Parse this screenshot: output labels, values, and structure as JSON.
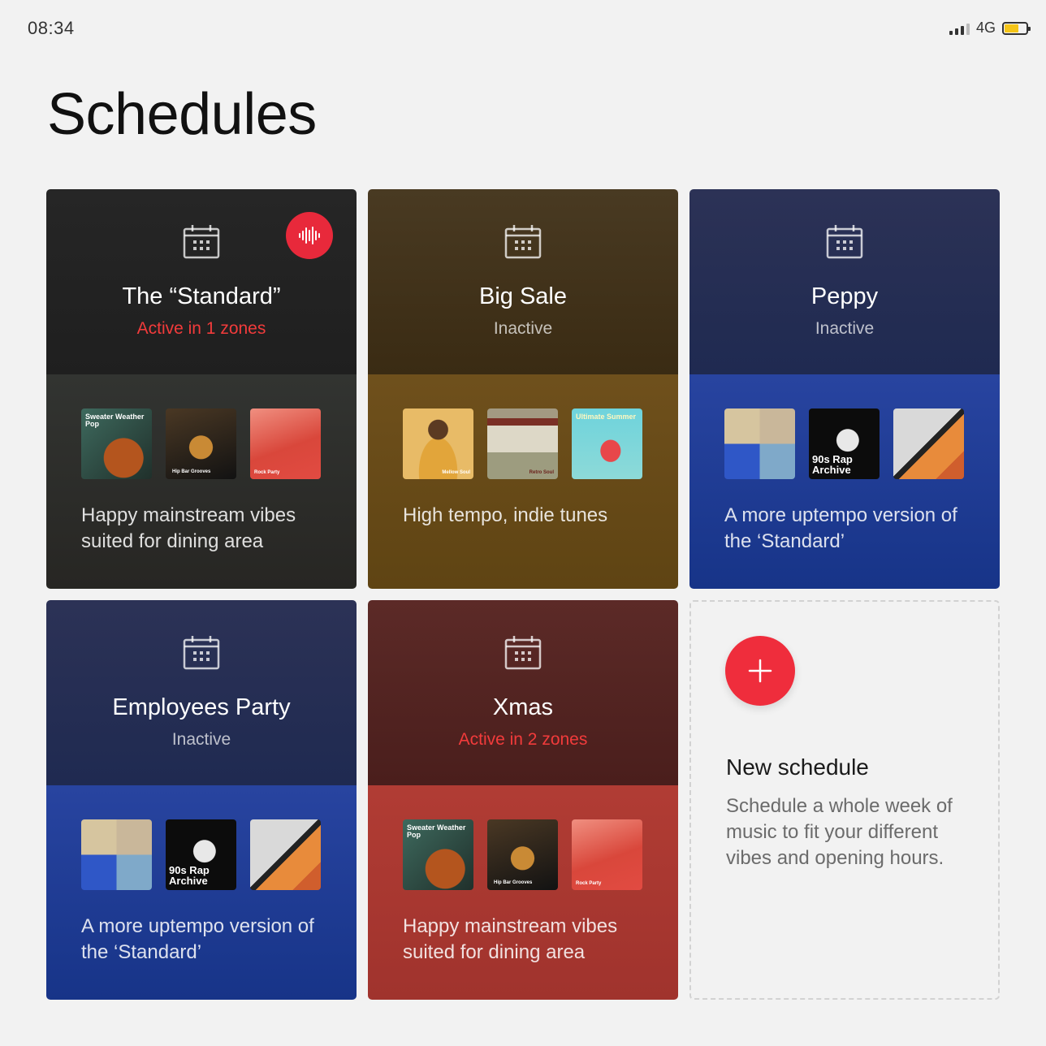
{
  "status_bar": {
    "time": "08:34",
    "network": "4G",
    "battery_level": 0.65,
    "battery_color": "#f5c518"
  },
  "page": {
    "title": "Schedules"
  },
  "accent_color": "#e8293b",
  "schedules": [
    {
      "title": "The “Standard”",
      "status": "Active in 1 zones",
      "active": true,
      "now_playing": true,
      "description": "Happy mainstream vibes suited for dining area",
      "playlists": [
        "Sweater Weather Pop",
        "Hip Bar Grooves",
        "Rock Party"
      ]
    },
    {
      "title": "Big Sale",
      "status": "Inactive",
      "active": false,
      "description": "High tempo, indie tunes",
      "playlists": [
        "Mellow Soul",
        "Retro Soul",
        "Ultimate Summer"
      ]
    },
    {
      "title": "Peppy",
      "status": "Inactive",
      "active": false,
      "description": "A more uptempo version of the ‘Standard’",
      "playlists": [
        "",
        "90s Rap Archive",
        ""
      ]
    },
    {
      "title": "Employees Party",
      "status": "Inactive",
      "active": false,
      "description": "A more uptempo version of the ‘Standard’",
      "playlists": [
        "",
        "90s Rap Archive",
        ""
      ]
    },
    {
      "title": "Xmas",
      "status": "Active in 2 zones",
      "active": true,
      "description": "Happy mainstream vibes suited for dining area",
      "playlists": [
        "Sweater Weather Pop",
        "Hip Bar Grooves",
        "Rock Party"
      ]
    }
  ],
  "new_schedule": {
    "title": "New schedule",
    "description": "Schedule a whole week of music to fit your different vibes and opening hours."
  }
}
